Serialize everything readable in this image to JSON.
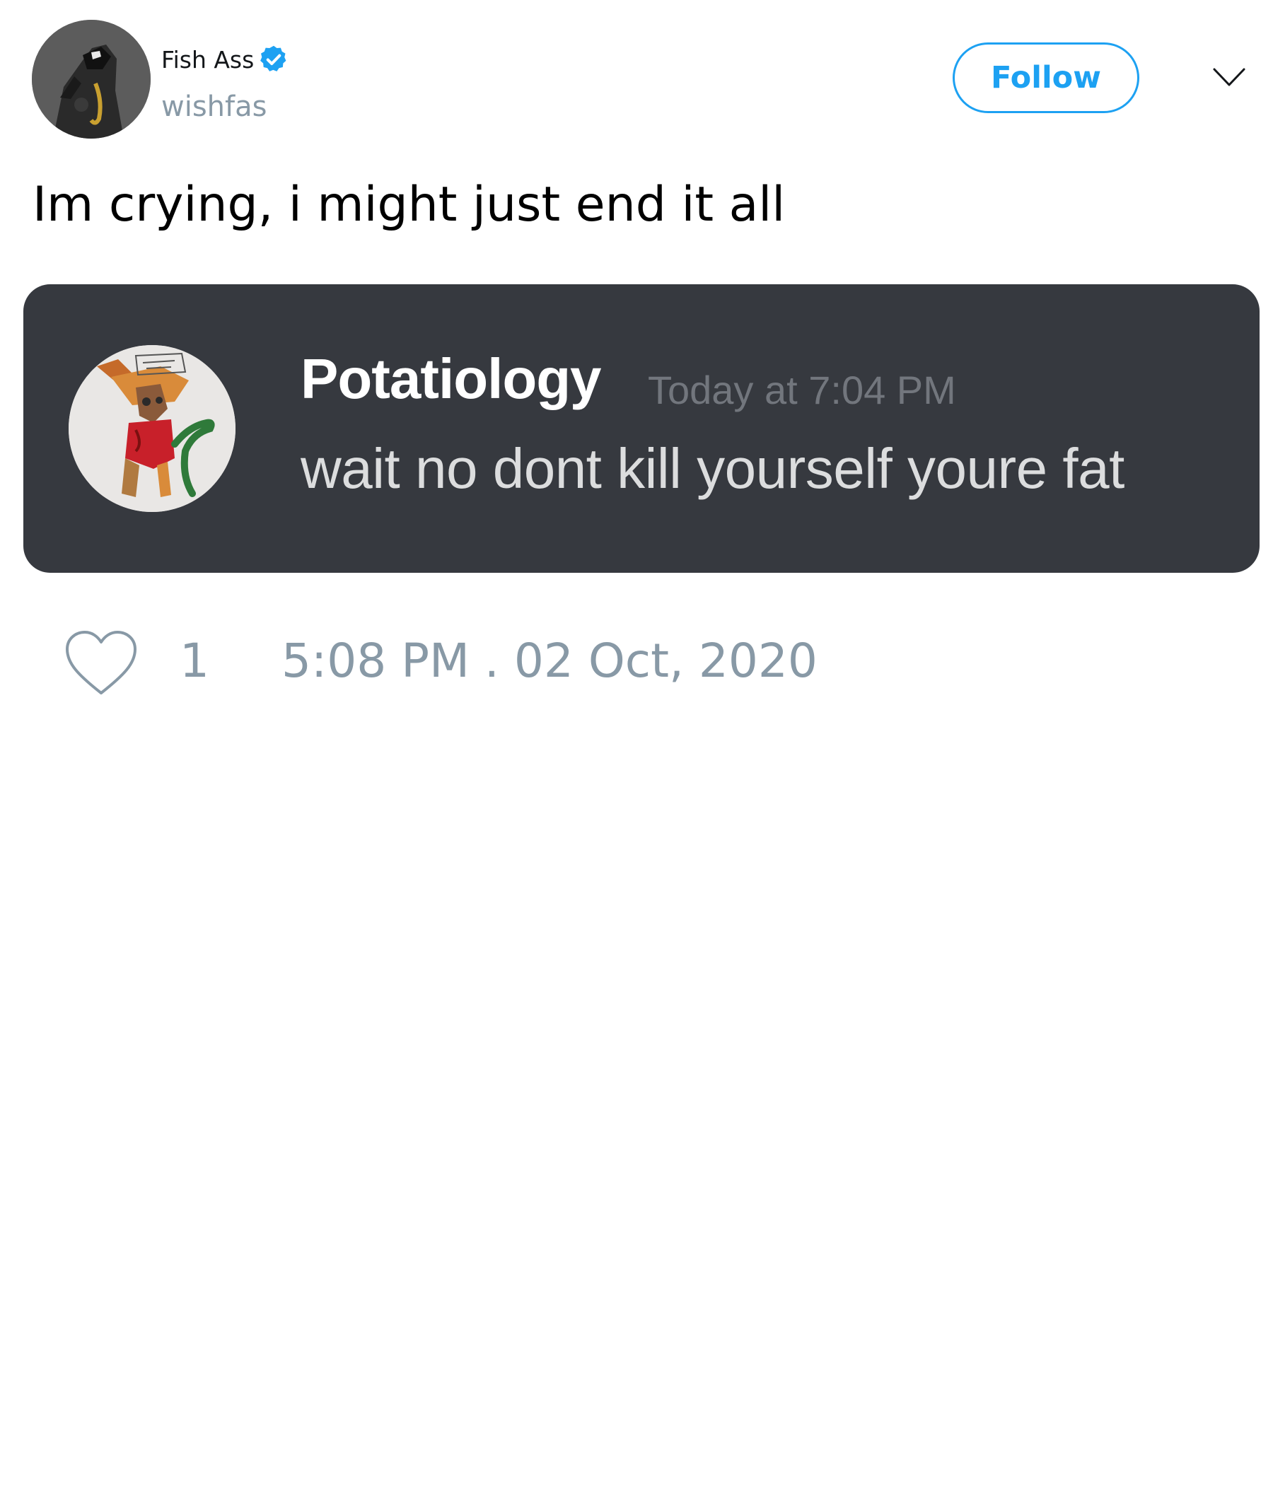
{
  "author": {
    "display_name": "Fish Ass",
    "handle": "wishfas",
    "verified_icon": "verified-badge-icon"
  },
  "header": {
    "follow_label": "Follow",
    "menu_icon": "chevron-down-icon"
  },
  "tweet": {
    "text": "Im crying, i might just end it all"
  },
  "embedded_screenshot": {
    "username": "Potatiology",
    "timestamp": "Today at 7:04 PM",
    "message": "wait no dont kill yourself youre fat"
  },
  "footer": {
    "like_icon": "heart-icon",
    "like_count": "1",
    "timestamp": "5:08 PM . 02 Oct, 2020"
  },
  "colors": {
    "accent": "#1da1f2",
    "muted": "#8899a6",
    "discord_bg": "#36393f"
  }
}
